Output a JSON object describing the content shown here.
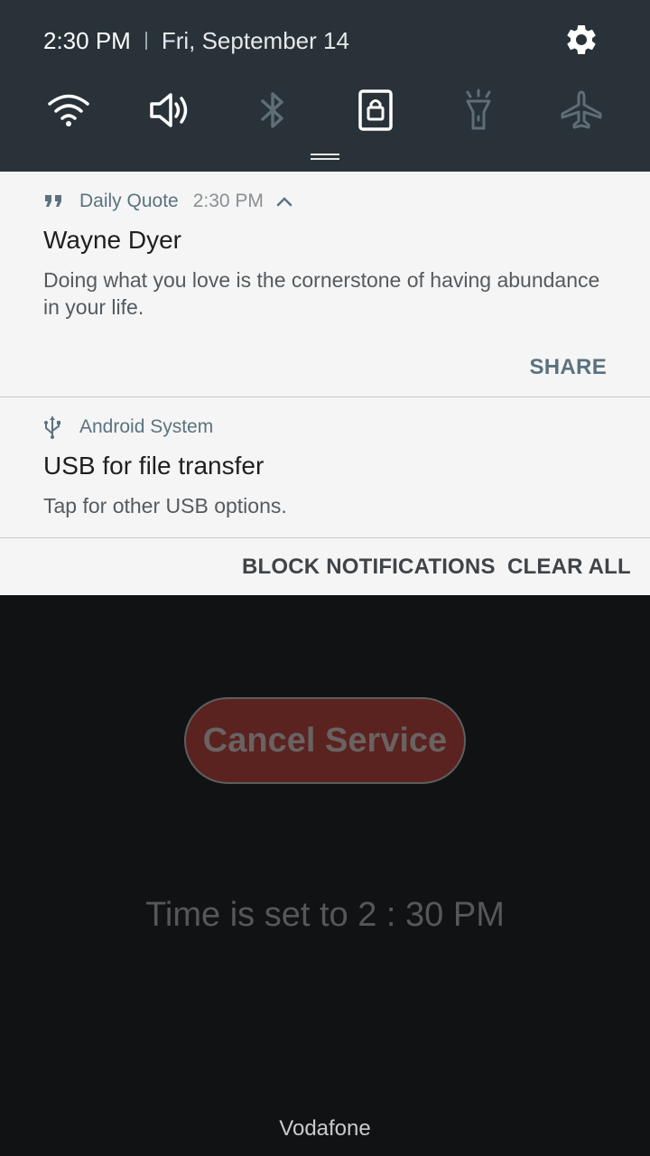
{
  "quick_settings": {
    "time": "2:30 PM",
    "date": "Fri, September 14",
    "tiles": [
      {
        "name": "wifi-icon",
        "state": "on"
      },
      {
        "name": "volume-icon",
        "state": "on"
      },
      {
        "name": "bluetooth-icon",
        "state": "off"
      },
      {
        "name": "screen-lock-icon",
        "state": "on"
      },
      {
        "name": "flashlight-icon",
        "state": "off"
      },
      {
        "name": "airplane-icon",
        "state": "off"
      }
    ],
    "colors": {
      "panel": "#283238",
      "tile_on": "#ffffff",
      "tile_off": "#5f6d74"
    }
  },
  "notifications": [
    {
      "app": "Daily Quote",
      "time": "2:30 PM",
      "title": "Wayne Dyer",
      "text": "Doing what you love is the cornerstone of having abundance in your life.",
      "action": "SHARE",
      "icon": "quote-icon"
    },
    {
      "app": "Android System",
      "title": "USB for file transfer",
      "text": "Tap for other USB options.",
      "icon": "usb-icon"
    }
  ],
  "footer": {
    "block_label": "BLOCK NOTIFICATIONS",
    "clear_label": "CLEAR ALL"
  },
  "app": {
    "cancel_label": "Cancel Service",
    "time_text": "Time is set to 2 : 30 PM",
    "carrier": "Vodafone"
  }
}
